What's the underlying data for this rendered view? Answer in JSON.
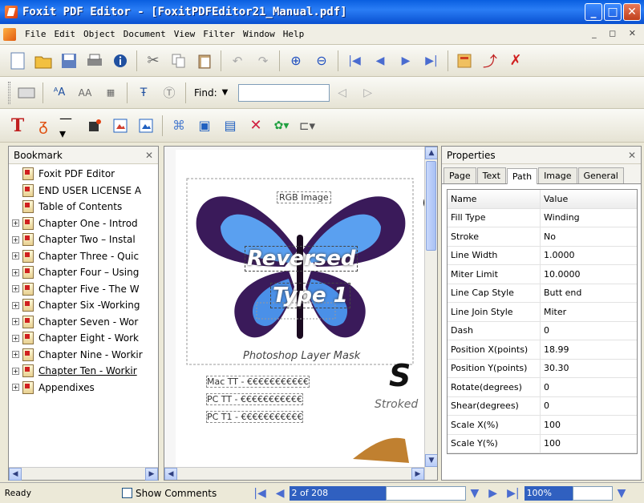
{
  "window": {
    "title": "Foxit PDF Editor - [FoxitPDFEditor21_Manual.pdf]"
  },
  "menu": {
    "items": [
      "File",
      "Edit",
      "Object",
      "Document",
      "View",
      "Filter",
      "Window",
      "Help"
    ]
  },
  "toolbar": {
    "find_label": "Find:",
    "find_value": ""
  },
  "bookmark": {
    "title": "Bookmark",
    "items": [
      {
        "label": "Foxit PDF Editor",
        "expandable": false
      },
      {
        "label": "END USER LICENSE A",
        "expandable": false
      },
      {
        "label": "Table of Contents",
        "expandable": false
      },
      {
        "label": "Chapter One - Introd",
        "expandable": true
      },
      {
        "label": "Chapter Two – Instal",
        "expandable": true
      },
      {
        "label": "Chapter Three - Quic",
        "expandable": true
      },
      {
        "label": "Chapter Four – Using",
        "expandable": true
      },
      {
        "label": "Chapter Five - The W",
        "expandable": true
      },
      {
        "label": "Chapter Six -Working",
        "expandable": true
      },
      {
        "label": "Chapter Seven - Wor",
        "expandable": true
      },
      {
        "label": "Chapter Eight - Work",
        "expandable": true
      },
      {
        "label": "Chapter Nine - Workir",
        "expandable": true
      },
      {
        "label": "Chapter Ten - Workir",
        "expandable": true
      },
      {
        "label": "Appendixes",
        "expandable": true
      }
    ]
  },
  "document": {
    "rgb_label": "RGB Image",
    "reversed": "Reversed",
    "type1": "Type 1",
    "mask_label": "Photoshop Layer Mask",
    "mac_line": "Mac TT - €€€€€€€€€€€",
    "pc_line1": "PC TT - €€€€€€€€€€€",
    "pc_line2": "PC T1 - €€€€€€€€€€€",
    "big_s": "S",
    "stroked": "Stroked"
  },
  "properties": {
    "title": "Properties",
    "tabs": [
      "Page",
      "Text",
      "Path",
      "Image",
      "General"
    ],
    "active_tab": "Path",
    "header": {
      "name": "Name",
      "value": "Value"
    },
    "rows": [
      {
        "name": "Fill Type",
        "value": "Winding"
      },
      {
        "name": "Stroke",
        "value": "No"
      },
      {
        "name": "Line Width",
        "value": "1.0000"
      },
      {
        "name": "Miter Limit",
        "value": "10.0000"
      },
      {
        "name": "Line Cap Style",
        "value": "Butt end"
      },
      {
        "name": "Line Join Style",
        "value": "Miter"
      },
      {
        "name": "Dash",
        "value": "0"
      },
      {
        "name": "Position X(points)",
        "value": "18.99"
      },
      {
        "name": "Position Y(points)",
        "value": "30.30"
      },
      {
        "name": "Rotate(degrees)",
        "value": "0"
      },
      {
        "name": "Shear(degrees)",
        "value": "0"
      },
      {
        "name": "Scale X(%)",
        "value": "100"
      },
      {
        "name": "Scale Y(%)",
        "value": "100"
      }
    ]
  },
  "status": {
    "ready": "Ready",
    "show_comments": "Show Comments",
    "page": "2 of 208",
    "zoom": "100%"
  },
  "colors": {
    "title_bar": "#0a5fe0",
    "selection": "#3060c0"
  }
}
